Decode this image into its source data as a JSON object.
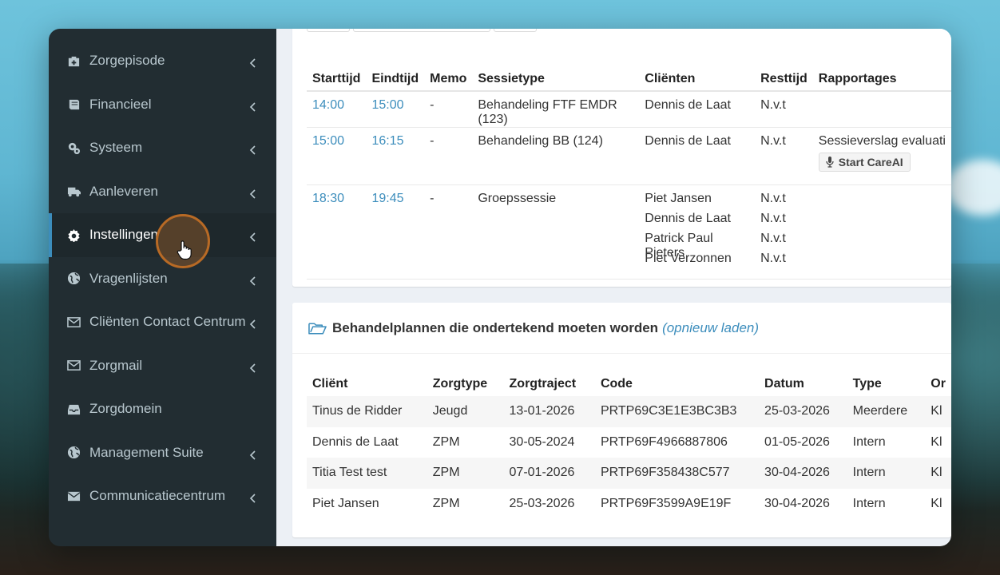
{
  "sidebar": {
    "items": [
      {
        "label": "Zorgepisode",
        "icon": "medkit-icon",
        "chevron": true
      },
      {
        "label": "Financieel",
        "icon": "book-icon",
        "chevron": true
      },
      {
        "label": "Systeem",
        "icon": "gears-icon",
        "chevron": true
      },
      {
        "label": "Aanleveren",
        "icon": "truck-icon",
        "chevron": true
      },
      {
        "label": "Instellingen",
        "icon": "gear-icon",
        "chevron": true,
        "active": true
      },
      {
        "label": "Vragenlijsten",
        "icon": "globe-icon",
        "chevron": true
      },
      {
        "label": "Cliënten Contact Centrum",
        "icon": "envelope-icon",
        "chevron": true
      },
      {
        "label": "Zorgmail",
        "icon": "envelope-icon",
        "chevron": true
      },
      {
        "label": "Zorgdomein",
        "icon": "inbox-icon",
        "chevron": false
      },
      {
        "label": "Management Suite",
        "icon": "globe-icon",
        "chevron": true
      },
      {
        "label": "Communicatiecentrum",
        "icon": "envelope-solid-icon",
        "chevron": true
      }
    ]
  },
  "sessions": {
    "headers": [
      "Starttijd",
      "Eindtijd",
      "Memo",
      "Sessietype",
      "Cliënten",
      "Resttijd",
      "Rapportages"
    ],
    "rows": [
      {
        "start": "14:00",
        "end": "15:00",
        "memo": "-",
        "type": "Behandeling FTF EMDR (123)",
        "clients": [
          "Dennis de Laat"
        ],
        "rest": [
          "N.v.t"
        ],
        "report": ""
      },
      {
        "start": "15:00",
        "end": "16:15",
        "memo": "-",
        "type": "Behandeling BB (124)",
        "clients": [
          "Dennis de Laat"
        ],
        "rest": [
          "N.v.t"
        ],
        "report": "Sessieverslag evaluati",
        "button": "Start CareAI"
      },
      {
        "start": "18:30",
        "end": "19:45",
        "memo": "-",
        "type": "Groepssessie",
        "clients": [
          "Piet Jansen",
          "Dennis de Laat",
          "Patrick Paul Pieters",
          "Piet Verzonnen"
        ],
        "rest": [
          "N.v.t",
          "N.v.t",
          "N.v.t",
          "N.v.t"
        ],
        "report": ""
      }
    ]
  },
  "plans": {
    "title": "Behandelplannen die ondertekend moeten worden",
    "reload": "(opnieuw laden)",
    "headers": [
      "Cliënt",
      "Zorgtype",
      "Zorgtraject",
      "Code",
      "Datum",
      "Type",
      "Or"
    ],
    "rows": [
      [
        "Tinus de Ridder",
        "Jeugd",
        "13-01-2026",
        "PRTP69C3E1E3BC3B3",
        "25-03-2026",
        "Meerdere",
        "Kl"
      ],
      [
        "Dennis de Laat",
        "ZPM",
        "30-05-2024",
        "PRTP69F4966887806",
        "01-05-2026",
        "Intern",
        "Kl"
      ],
      [
        "Titia Test test",
        "ZPM",
        "07-01-2026",
        "PRTP69F358438C577",
        "30-04-2026",
        "Intern",
        "Kl"
      ],
      [
        "Piet Jansen",
        "ZPM",
        "25-03-2026",
        "PRTP69F3599A9E19F",
        "30-04-2026",
        "Intern",
        "Kl"
      ]
    ]
  },
  "colors": {
    "sidebar_bg": "#222d32",
    "accent": "#3c8dbc",
    "link": "#3c8dbc"
  }
}
